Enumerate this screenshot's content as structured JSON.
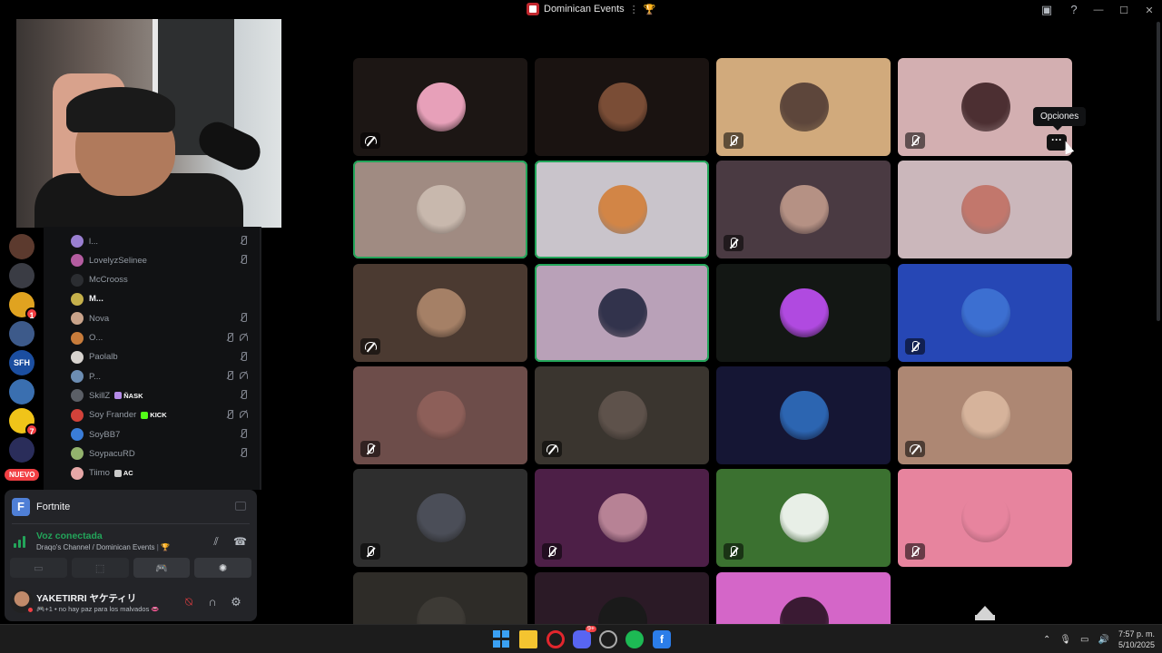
{
  "window": {
    "title": "Dominican Events",
    "title_separator": "⋮",
    "title_trophy": "🏆"
  },
  "server_badges": {
    "badge1": "1",
    "badge2": "7"
  },
  "nuevo_label": "NUEVO",
  "members": [
    {
      "name": "l...",
      "bold": false,
      "tag": "",
      "muted": true,
      "deaf": false,
      "color": "#9a7fd1"
    },
    {
      "name": "LovelyzSelinee",
      "bold": false,
      "tag": "",
      "muted": true,
      "deaf": false,
      "color": "#b45ca0"
    },
    {
      "name": "McCrooss",
      "bold": false,
      "tag": "",
      "muted": false,
      "deaf": false,
      "color": "#2b2d31"
    },
    {
      "name": "M...",
      "bold": true,
      "tag": "",
      "muted": false,
      "deaf": false,
      "color": "#c5b04b"
    },
    {
      "name": "Nova",
      "bold": false,
      "tag": "",
      "muted": true,
      "deaf": false,
      "color": "#c9a38a"
    },
    {
      "name": "O...",
      "bold": false,
      "tag": "",
      "muted": true,
      "deaf": true,
      "color": "#c87c3b"
    },
    {
      "name": "Paolalb",
      "bold": false,
      "tag": "",
      "muted": true,
      "deaf": false,
      "color": "#d7d3cf"
    },
    {
      "name": "P...",
      "bold": false,
      "tag": "",
      "muted": true,
      "deaf": true,
      "color": "#6c8db3"
    },
    {
      "name": "SkillZ",
      "bold": false,
      "tag": "ÑASK",
      "tag_color": "#b58be8",
      "muted": true,
      "deaf": false,
      "color": "#5b5f66"
    },
    {
      "name": "Soy Frander",
      "bold": false,
      "tag": "KICK",
      "tag_color": "#53fc18",
      "muted": true,
      "deaf": true,
      "color": "#d2423a"
    },
    {
      "name": "SoyBB7",
      "bold": false,
      "tag": "",
      "muted": true,
      "deaf": false,
      "color": "#3a7dd8"
    },
    {
      "name": "SoypacuRD",
      "bold": false,
      "tag": "",
      "muted": true,
      "deaf": false,
      "color": "#93b36d"
    },
    {
      "name": "Tiimo",
      "bold": false,
      "tag": "AC",
      "tag_color": "#c9c9c9",
      "muted": false,
      "deaf": false,
      "color": "#e6a7a7"
    }
  ],
  "voice_panel": {
    "game_name": "Fortnite",
    "game_letter": "F",
    "status_title": "Voz conectada",
    "status_sub": "Draqo's Channel / Dominican Events",
    "user_name": "YAKETIRRI ヤケティリ",
    "user_status": "🎮+1 • no hay paz para los malvados 👄"
  },
  "tooltip": "Opciones",
  "more_label": "···",
  "tiles": [
    {
      "bg": "#1c1614",
      "av": "#e7a0b9",
      "badge": "deaf",
      "speaking": false
    },
    {
      "bg": "#1a1311",
      "av": "#7a4d36",
      "badge": "",
      "speaking": false
    },
    {
      "bg": "#d1aa7c",
      "av": "#5d463b",
      "badge": "mute",
      "speaking": false
    },
    {
      "bg": "#d3afb1",
      "av": "#4c2f32",
      "badge": "mute",
      "speaking": false
    },
    {
      "bg": "#a08b82",
      "av": "#c8b8ad",
      "badge": "",
      "speaking": true
    },
    {
      "bg": "#c9c4cb",
      "av": "#d28546",
      "badge": "",
      "speaking": true
    },
    {
      "bg": "#4a3a42",
      "av": "#b59184",
      "badge": "mute",
      "speaking": false
    },
    {
      "bg": "#cbb7bb",
      "av": "#c2776c",
      "badge": "",
      "speaking": false
    },
    {
      "bg": "#4b3a31",
      "av": "#a58066",
      "badge": "deaf",
      "speaking": false
    },
    {
      "bg": "#b9a1b8",
      "av": "#32334c",
      "badge": "",
      "speaking": true
    },
    {
      "bg": "#131714",
      "av": "#b04ae0",
      "badge": "",
      "speaking": false
    },
    {
      "bg": "#2647b5",
      "av": "#3c6fd1",
      "badge": "mute",
      "speaking": false
    },
    {
      "bg": "#6d4d4a",
      "av": "#8d5f59",
      "badge": "mute",
      "speaking": false
    },
    {
      "bg": "#3a352f",
      "av": "#5e524b",
      "badge": "deaf",
      "speaking": false
    },
    {
      "bg": "#151634",
      "av": "#2c65b1",
      "badge": "",
      "speaking": false
    },
    {
      "bg": "#ad8773",
      "av": "#d6b39b",
      "badge": "deaf",
      "speaking": false
    },
    {
      "bg": "#2e2e2e",
      "av": "#4b4e58",
      "badge": "mute",
      "speaking": false
    },
    {
      "bg": "#4d1f47",
      "av": "#b78295",
      "badge": "mute",
      "speaking": false
    },
    {
      "bg": "#3b7130",
      "av": "#e8efe7",
      "badge": "mute",
      "speaking": false
    },
    {
      "bg": "#e7849e",
      "av": "#e7849e",
      "badge": "mute",
      "speaking": false
    },
    {
      "bg": "#2e2c28",
      "av": "#3d3a35",
      "badge": "",
      "speaking": false
    },
    {
      "bg": "#2b1a26",
      "av": "#1a1a1a",
      "badge": "",
      "speaking": false
    },
    {
      "bg": "#d466c8",
      "av": "#3a1a33",
      "badge": "",
      "speaking": false
    },
    {
      "bg": "#000000",
      "av": "#000000",
      "badge": "",
      "speaking": false
    }
  ],
  "taskbar": {
    "time": "7:57 p. m.",
    "date": "5/10/2025",
    "discord_badge": "9+"
  }
}
